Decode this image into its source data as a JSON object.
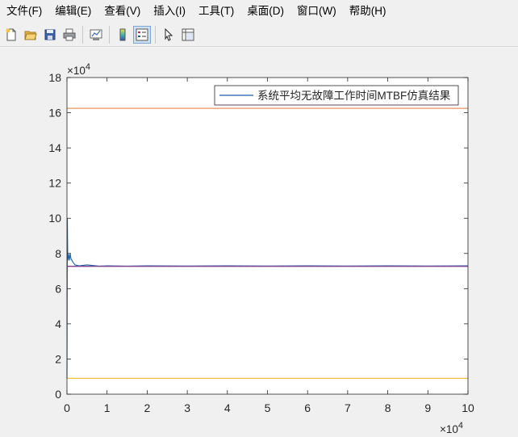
{
  "menu": [
    {
      "label": "文件(F)"
    },
    {
      "label": "编辑(E)"
    },
    {
      "label": "查看(V)"
    },
    {
      "label": "插入(I)"
    },
    {
      "label": "工具(T)"
    },
    {
      "label": "桌面(D)"
    },
    {
      "label": "窗口(W)"
    },
    {
      "label": "帮助(H)"
    }
  ],
  "toolbar_icons": [
    "new-file-icon",
    "open-folder-icon",
    "save-icon",
    "print-icon",
    "link-plot-icon",
    "colorbar-icon",
    "legend-icon",
    "pointer-icon",
    "property-inspector-icon"
  ],
  "axes_toolbar_icons": [
    "brush-icon",
    "data-tips-icon",
    "data-cursor-icon",
    "pan-icon",
    "zoom-in-icon",
    "zoom-out-icon",
    "home-icon"
  ],
  "colors": {
    "upper_bound": "#e8955e",
    "lower_bound": "#eebe3f",
    "simulation": "#1f5fa8",
    "mean_line": "#7e3f8f"
  },
  "chart_data": {
    "type": "line",
    "title": "",
    "xlabel": "",
    "ylabel": "",
    "xlim": [
      0,
      10
    ],
    "ylim": [
      0,
      18
    ],
    "x_exponent_label": "×10",
    "x_exponent": "4",
    "y_exponent_label": "×10",
    "y_exponent": "4",
    "xticks": [
      "0",
      "1",
      "2",
      "3",
      "4",
      "5",
      "6",
      "7",
      "8",
      "9",
      "10"
    ],
    "yticks": [
      "0",
      "2",
      "4",
      "6",
      "8",
      "10",
      "12",
      "14",
      "16",
      "18"
    ],
    "grid": false,
    "legend": {
      "location": "top-right",
      "entries": [
        "系统平均无故障工作时间MTBF仿真结果"
      ]
    },
    "series": [
      {
        "name": "系统平均无故障工作时间MTBF仿真结果",
        "color": "#1f5fa8",
        "x": [
          0,
          0.01,
          0.02,
          0.04,
          0.06,
          0.08,
          0.1,
          0.15,
          0.2,
          0.3,
          0.5,
          0.8,
          1,
          1.5,
          2,
          3,
          4,
          5,
          6,
          7,
          8,
          9,
          10
        ],
        "y": [
          0.9,
          10.0,
          7.6,
          7.95,
          7.6,
          8.0,
          7.7,
          7.5,
          7.35,
          7.3,
          7.35,
          7.28,
          7.3,
          7.28,
          7.3,
          7.29,
          7.3,
          7.29,
          7.3,
          7.29,
          7.3,
          7.29,
          7.3
        ]
      },
      {
        "color": "#7e3f8f",
        "x": [
          0,
          10
        ],
        "y": [
          7.27,
          7.27
        ]
      },
      {
        "color": "#e8955e",
        "x": [
          0,
          10
        ],
        "y": [
          16.25,
          16.25
        ]
      },
      {
        "color": "#eebe3f",
        "x": [
          0,
          10
        ],
        "y": [
          0.9,
          0.9
        ]
      }
    ]
  }
}
